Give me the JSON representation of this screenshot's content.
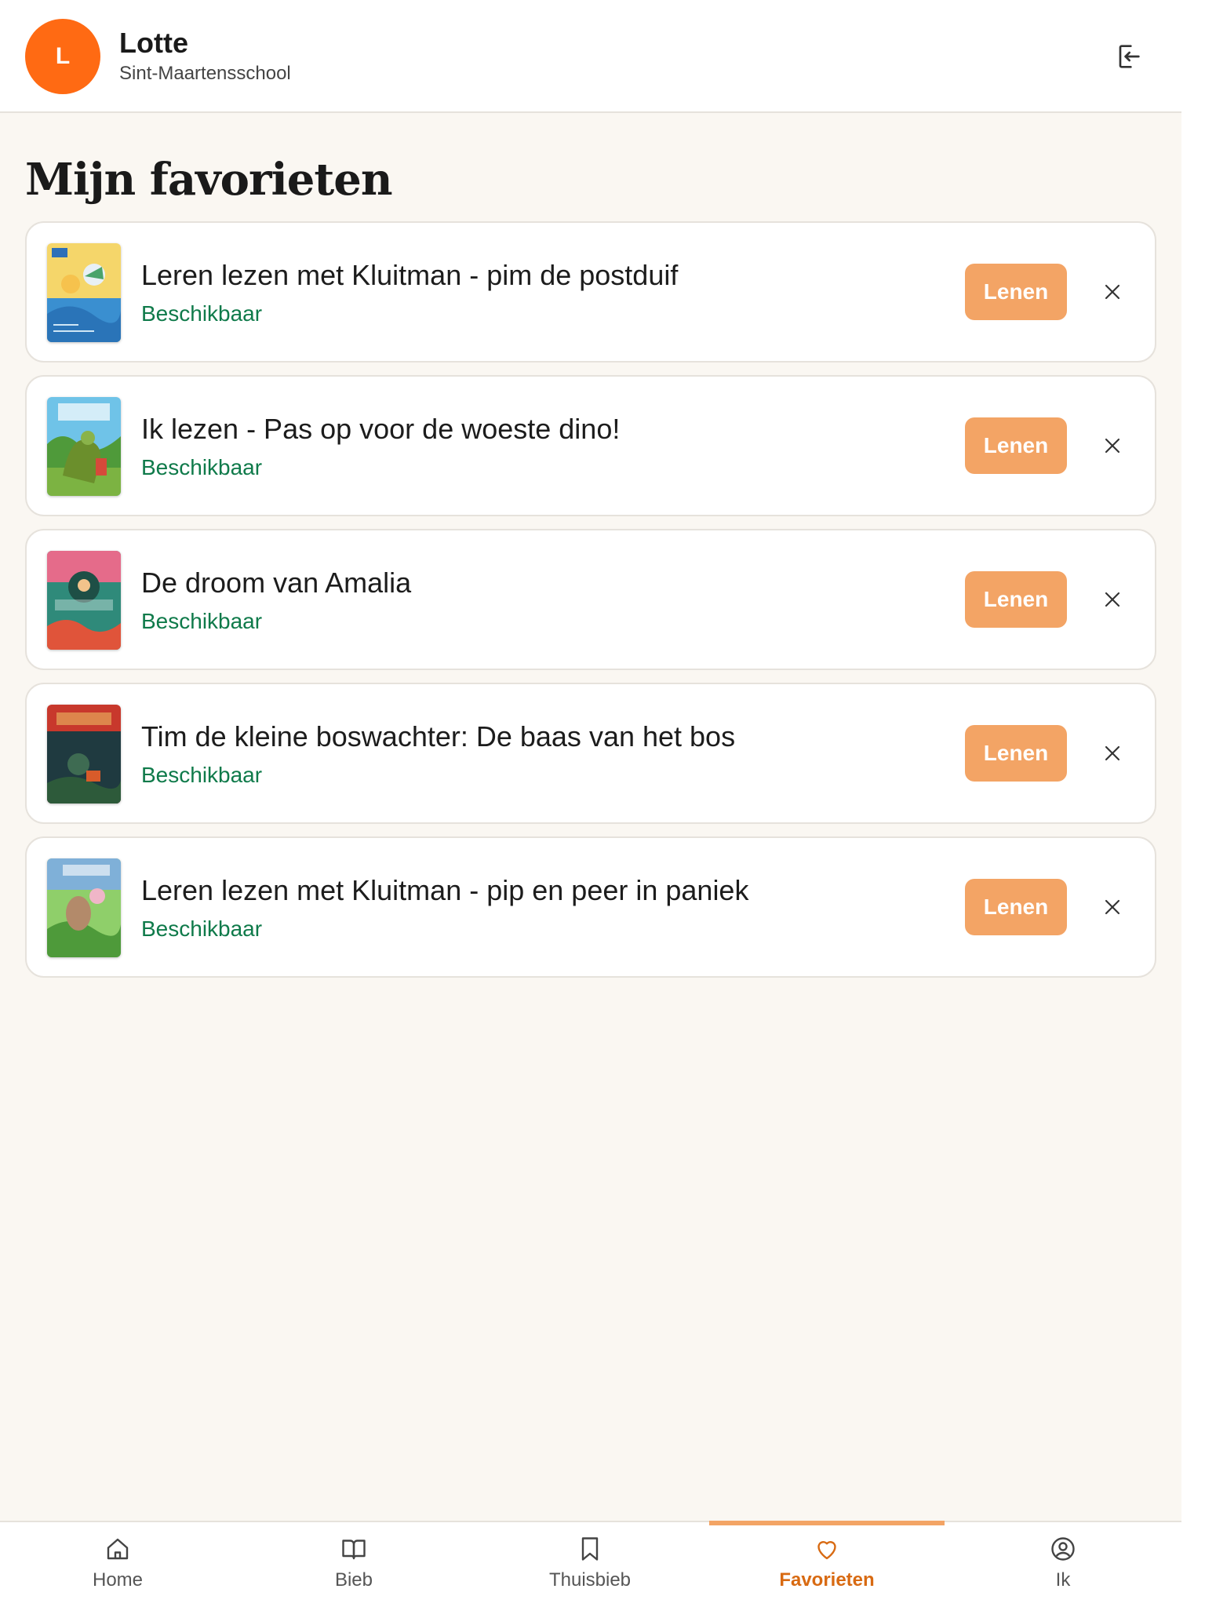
{
  "header": {
    "avatar_initial": "L",
    "user_name": "Lotte",
    "school": "Sint-Maartensschool",
    "logout_icon": "logout-icon"
  },
  "page_title": "Mijn favorieten",
  "favorites": [
    {
      "title": "Leren lezen met Kluitman - pim de postduif",
      "status": "Beschikbaar",
      "lend_label": "Lenen"
    },
    {
      "title": "Ik lezen - Pas op voor de woeste dino!",
      "status": "Beschikbaar",
      "lend_label": "Lenen"
    },
    {
      "title": "De droom van Amalia",
      "status": "Beschikbaar",
      "lend_label": "Lenen"
    },
    {
      "title": "Tim de kleine boswachter: De baas van het bos",
      "status": "Beschikbaar",
      "lend_label": "Lenen"
    },
    {
      "title": "Leren lezen met Kluitman - pip en peer in paniek",
      "status": "Beschikbaar",
      "lend_label": "Lenen"
    }
  ],
  "nav": {
    "items": [
      {
        "label": "Home",
        "icon": "home-icon"
      },
      {
        "label": "Bieb",
        "icon": "book-open-icon"
      },
      {
        "label": "Thuisbieb",
        "icon": "bookmark-icon"
      },
      {
        "label": "Favorieten",
        "icon": "heart-icon"
      },
      {
        "label": "Ik",
        "icon": "user-circle-icon"
      }
    ],
    "active": "Favorieten"
  },
  "colors": {
    "accent": "#f3a465",
    "avatar": "#ff6a13",
    "available": "#0f7a4a",
    "background": "#faf7f2",
    "active_nav": "#d86a12"
  }
}
